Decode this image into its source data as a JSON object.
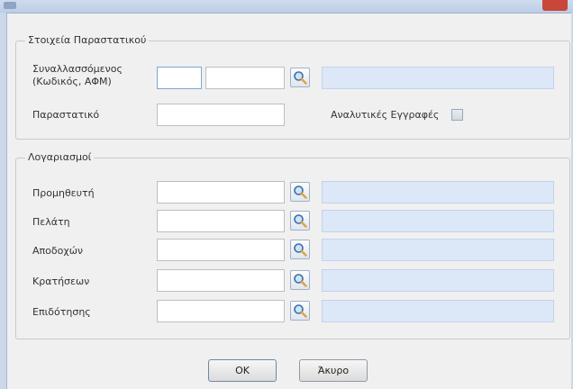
{
  "window": {
    "title": ""
  },
  "document_group": {
    "legend": "Στοιχεία Παραστατικού",
    "counterparty_label": "Συναλλασσόμενος",
    "counterparty_sublabel": "(Κωδικός, ΑΦΜ)",
    "counterparty_code": "",
    "counterparty_vat": "",
    "counterparty_name": "",
    "document_label": "Παραστατικό",
    "document_value": "",
    "detailed_entries_label": "Αναλυτικές Εγγραφές",
    "detailed_entries_checked": false
  },
  "accounts_group": {
    "legend": "Λογαριασμοί",
    "rows": [
      {
        "label": "Προμηθευτή",
        "code": "",
        "description": ""
      },
      {
        "label": "Πελάτη",
        "code": "",
        "description": ""
      },
      {
        "label": "Αποδοχών",
        "code": "",
        "description": ""
      },
      {
        "label": "Κρατήσεων",
        "code": "",
        "description": ""
      },
      {
        "label": "Επιδότησης",
        "code": "",
        "description": ""
      }
    ]
  },
  "buttons": {
    "ok": "OK",
    "cancel": "Άκυρο"
  },
  "icons": {
    "search": "magnifier-icon"
  },
  "colors": {
    "readonly_field": "#dce7f8",
    "frame": "#cbd8ea"
  }
}
